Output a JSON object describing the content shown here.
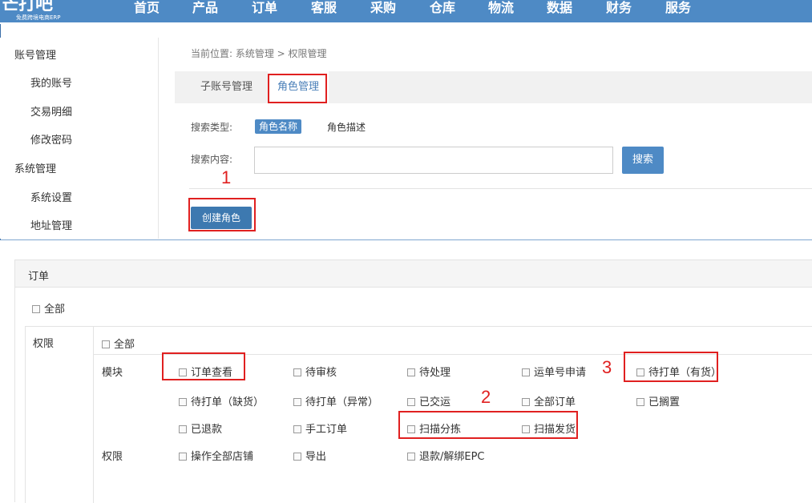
{
  "logo": {
    "mark": "芒打吧",
    "sub": "免费跨境电商ERP"
  },
  "nav": [
    "首页",
    "产品",
    "订单",
    "客服",
    "采购",
    "仓库",
    "物流",
    "数据",
    "财务",
    "服务"
  ],
  "sidebar": {
    "groups": [
      {
        "label": "账号管理",
        "items": [
          "我的账号",
          "交易明细",
          "修改密码"
        ]
      },
      {
        "label": "系统管理",
        "items": [
          "系统设置",
          "地址管理"
        ]
      }
    ]
  },
  "breadcrumb": "当前位置:  系统管理 > 权限管理",
  "tabs": [
    "子账号管理",
    "角色管理"
  ],
  "search": {
    "type_label": "搜索类型:",
    "type_options": [
      "角色名称",
      "角色描述"
    ],
    "content_label": "搜索内容:",
    "input_value": "",
    "button": "搜索"
  },
  "create_button": "创建角色",
  "annotations": [
    "1",
    "2",
    "3"
  ],
  "permissions": {
    "section_title": "订单",
    "select_all": "全部",
    "row_label": "权限",
    "inner_select_all": "全部",
    "module_label": "模块",
    "modules": [
      "订单查看",
      "待审核",
      "待处理",
      "运单号申请",
      "待打单（有货）",
      "待打单（缺货）",
      "待打单（异常）",
      "已交运",
      "全部订单",
      "已搁置",
      "已退款",
      "手工订单",
      "扫描分拣",
      "扫描发货"
    ],
    "rights_label": "权限",
    "rights": [
      "操作全部店铺",
      "导出",
      "退款/解绑EPC"
    ]
  },
  "colors": {
    "nav": "#4e8ac5",
    "button": "#4e8ac5",
    "annotation": "#e02020"
  }
}
